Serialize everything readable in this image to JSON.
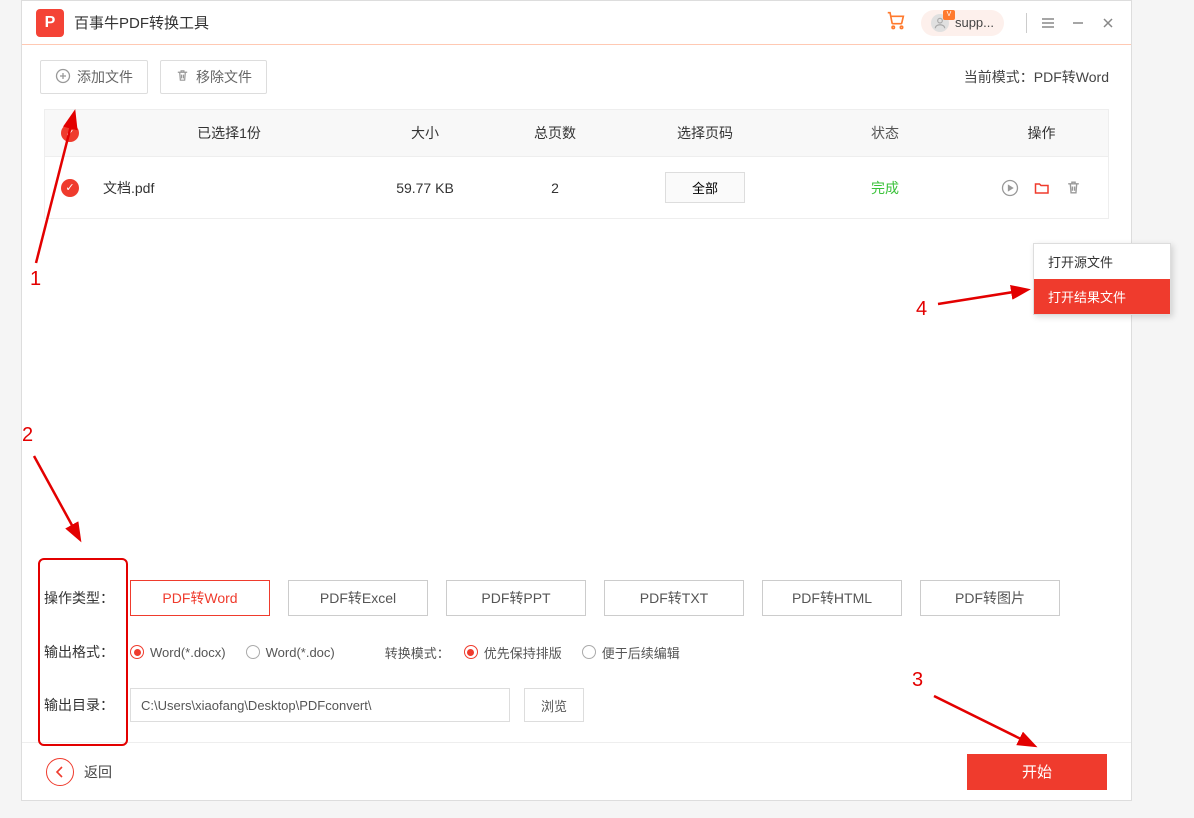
{
  "app_title": "百事牛PDF转换工具",
  "user_name": "supp...",
  "toolbar": {
    "add_file": "添加文件",
    "remove_file": "移除文件",
    "mode_label": "当前模式：PDF转Word"
  },
  "table": {
    "headers": {
      "selected": "已选择1份",
      "size": "大小",
      "pages": "总页数",
      "range": "选择页码",
      "status": "状态",
      "action": "操作"
    },
    "rows": [
      {
        "name": "文档.pdf",
        "size": "59.77 KB",
        "pages": "2",
        "range": "全部",
        "status": "完成"
      }
    ]
  },
  "context_menu": {
    "open_source": "打开源文件",
    "open_result": "打开结果文件"
  },
  "options": {
    "type_label": "操作类型：",
    "types": [
      "PDF转Word",
      "PDF转Excel",
      "PDF转PPT",
      "PDF转TXT",
      "PDF转HTML",
      "PDF转图片"
    ],
    "format_label": "输出格式：",
    "formats": [
      "Word(*.docx)",
      "Word(*.doc)"
    ],
    "convert_mode_label": "转换模式：",
    "convert_modes": [
      "优先保持排版",
      "便于后续编辑"
    ],
    "dir_label": "输出目录：",
    "dir_value": "C:\\Users\\xiaofang\\Desktop\\PDFconvert\\",
    "browse": "浏览"
  },
  "footer": {
    "back": "返回",
    "start": "开始"
  },
  "annotations": {
    "n1": "1",
    "n2": "2",
    "n3": "3",
    "n4": "4"
  }
}
